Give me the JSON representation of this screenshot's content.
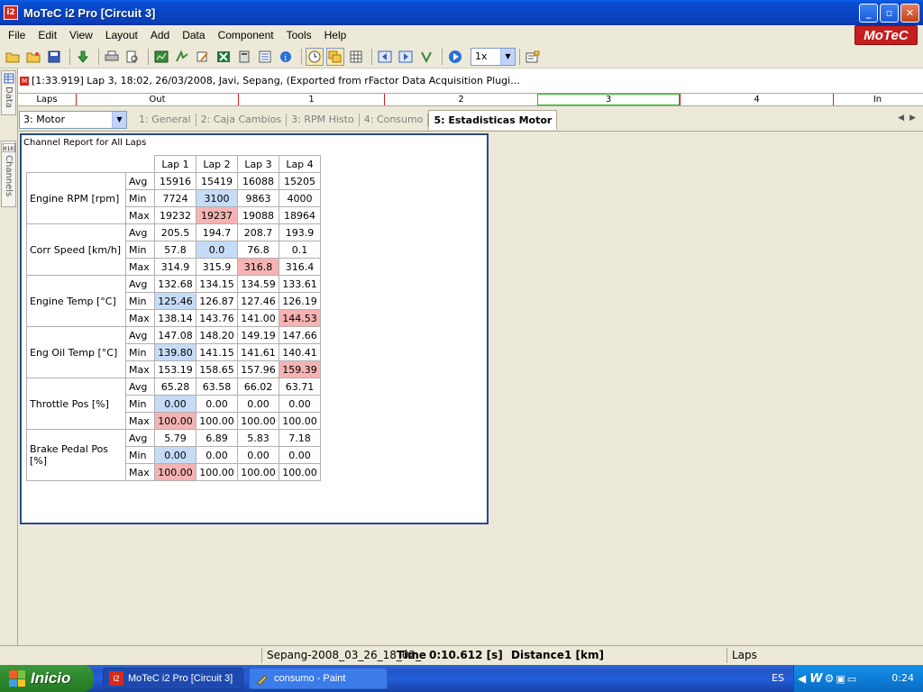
{
  "window": {
    "icon_text": "i2",
    "title": "MoTeC i2 Pro [Circuit 3]",
    "minimize": "_",
    "maximize": "▫",
    "close": "✕"
  },
  "brand": "MoTeC",
  "menu": [
    "File",
    "Edit",
    "View",
    "Layout",
    "Add",
    "Data",
    "Component",
    "Tools",
    "Help"
  ],
  "toolbar": {
    "zoom_value": "1x"
  },
  "sidebar": {
    "data_tab": "Data",
    "channels_tab": "Channels"
  },
  "lap_info": {
    "badge": "M",
    "text": "[1:33.919] Lap 3, 18:02, 26/03/2008, Javi, Sepang, (Exported from rFactor Data Acquisition Plugi..."
  },
  "lap_strip": {
    "label": "Laps",
    "segments": [
      "Out",
      "1",
      "2",
      "3",
      "4",
      "In"
    ],
    "active": "3"
  },
  "worksheet": {
    "selector": "3: Motor",
    "tabs": [
      "1: General",
      "2: Caja Cambios",
      "3: RPM Histo",
      "4: Consumo",
      "5: Estadisticas Motor"
    ],
    "active_tab": "5: Estadisticas Motor"
  },
  "report": {
    "title": "Channel Report for All Laps",
    "laps": [
      "Lap 1",
      "Lap 2",
      "Lap 3",
      "Lap 4"
    ],
    "stats": [
      "Avg",
      "Min",
      "Max"
    ],
    "channels": [
      {
        "name": "Engine RPM [rpm]",
        "rows": [
          [
            "15916",
            "15419",
            "16088",
            "15205"
          ],
          [
            "7724",
            "3100",
            "9863",
            "4000"
          ],
          [
            "19232",
            "19237",
            "19088",
            "18964"
          ]
        ],
        "lo": 1,
        "hi": 1
      },
      {
        "name": "Corr Speed [km/h]",
        "rows": [
          [
            "205.5",
            "194.7",
            "208.7",
            "193.9"
          ],
          [
            "57.8",
            "0.0",
            "76.8",
            "0.1"
          ],
          [
            "314.9",
            "315.9",
            "316.8",
            "316.4"
          ]
        ],
        "lo": 1,
        "hi": 2
      },
      {
        "name": "Engine Temp [°C]",
        "rows": [
          [
            "132.68",
            "134.15",
            "134.59",
            "133.61"
          ],
          [
            "125.46",
            "126.87",
            "127.46",
            "126.19"
          ],
          [
            "138.14",
            "143.76",
            "141.00",
            "144.53"
          ]
        ],
        "lo": 0,
        "hi": 3
      },
      {
        "name": "Eng Oil Temp [°C]",
        "rows": [
          [
            "147.08",
            "148.20",
            "149.19",
            "147.66"
          ],
          [
            "139.80",
            "141.15",
            "141.61",
            "140.41"
          ],
          [
            "153.19",
            "158.65",
            "157.96",
            "159.39"
          ]
        ],
        "lo": 0,
        "hi": 3
      },
      {
        "name": "Throttle Pos [%]",
        "rows": [
          [
            "65.28",
            "63.58",
            "66.02",
            "63.71"
          ],
          [
            "0.00",
            "0.00",
            "0.00",
            "0.00"
          ],
          [
            "100.00",
            "100.00",
            "100.00",
            "100.00"
          ]
        ],
        "lo": 0,
        "hi": 0
      },
      {
        "name": "Brake Pedal Pos [%]",
        "rows": [
          [
            "5.79",
            "6.89",
            "5.83",
            "7.18"
          ],
          [
            "0.00",
            "0.00",
            "0.00",
            "0.00"
          ],
          [
            "100.00",
            "100.00",
            "100.00",
            "100.00"
          ]
        ],
        "lo": 0,
        "hi": 0
      }
    ]
  },
  "status": {
    "file": "Sepang-2008_03_26_18_02_",
    "time_label": "Time",
    "time_value": "0:10.612 [s]",
    "distance_label": "Distance",
    "distance_value": "1 [km]",
    "mode": "Laps"
  },
  "taskbar": {
    "start": "Inicio",
    "tasks": [
      {
        "label": "MoTeC i2 Pro [Circuit 3]",
        "active": true
      },
      {
        "label": "consumo - Paint",
        "active": false
      }
    ],
    "lang": "ES",
    "clock": "0:24"
  },
  "colors": {
    "min_highlight": "#c6dcf6",
    "max_highlight": "#f5b3b3",
    "title_bar": "#0a4fd3"
  }
}
